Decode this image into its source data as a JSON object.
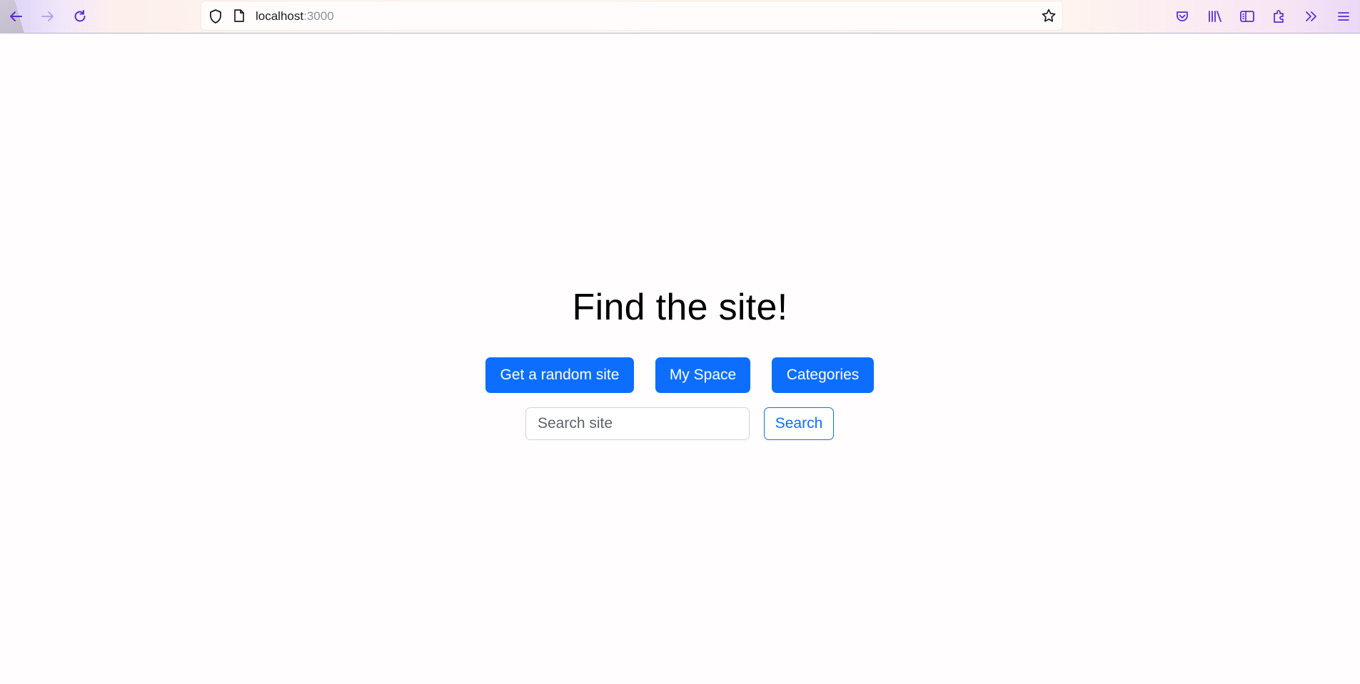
{
  "browser": {
    "url_host": "localhost",
    "url_port": ":3000",
    "icons": {
      "back": "back-arrow-icon",
      "forward": "forward-arrow-icon",
      "reload": "reload-icon",
      "shield": "tracking-protection-shield-icon",
      "page": "page-info-icon",
      "bookmark": "bookmark-star-icon",
      "pocket": "pocket-icon",
      "library": "library-icon",
      "sidebar": "sidebar-icon",
      "extensions": "extensions-icon",
      "overflow": "overflow-chevron-icon",
      "menu": "hamburger-menu-icon"
    },
    "accent_color": "#5b2dd3"
  },
  "page": {
    "title": "Find the site!",
    "buttons": {
      "random": "Get a random site",
      "myspace": "My Space",
      "categories": "Categories"
    },
    "search": {
      "placeholder": "Search site",
      "value": "",
      "button": "Search"
    },
    "colors": {
      "primary": "#0d6efd",
      "text": "#000000"
    }
  }
}
